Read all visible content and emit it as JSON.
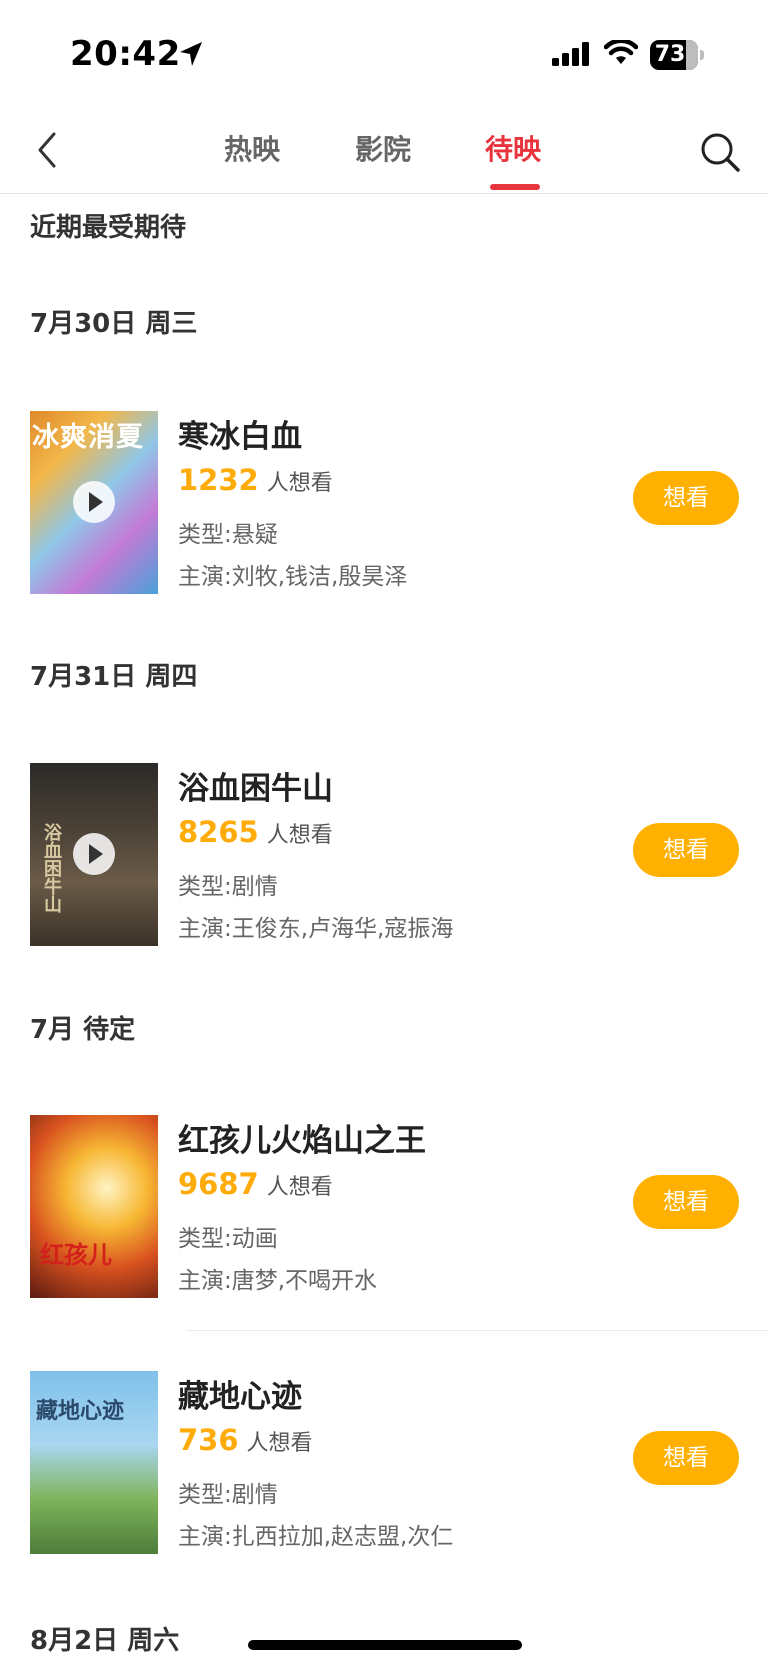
{
  "status_bar": {
    "time": "20:42",
    "battery": "73"
  },
  "nav": {
    "tabs": [
      {
        "label": "热映"
      },
      {
        "label": "影院"
      },
      {
        "label": "待映"
      }
    ],
    "active_tab": "待映"
  },
  "sections": {
    "featured_title": "近期最受期待",
    "dates": [
      "7月30日 周三",
      "7月31日 周四",
      "7月 待定",
      "8月2日 周六"
    ]
  },
  "movies": [
    {
      "title": "寒冰白血",
      "want_count": "1232",
      "want_suffix": "人想看",
      "genre": "类型:悬疑",
      "cast": "主演:刘牧,钱洁,殷昊泽",
      "button": "想看",
      "poster_text": "冰爽消夏"
    },
    {
      "title": "浴血困牛山",
      "want_count": "8265",
      "want_suffix": "人想看",
      "genre": "类型:剧情",
      "cast": "主演:王俊东,卢海华,寇振海",
      "button": "想看",
      "poster_text": "浴血困牛山"
    },
    {
      "title": "红孩儿火焰山之王",
      "want_count": "9687",
      "want_suffix": "人想看",
      "genre": "类型:动画",
      "cast": "主演:唐梦,不喝开水",
      "button": "想看",
      "poster_text": "红孩儿"
    },
    {
      "title": "藏地心迹",
      "want_count": "736",
      "want_suffix": "人想看",
      "genre": "类型:剧情",
      "cast": "主演:扎西拉加,赵志盟,次仁",
      "button": "想看",
      "poster_text": "藏地心迹"
    }
  ],
  "colors": {
    "accent_red": "#e8343d",
    "want_orange": "#ffac0a",
    "button_orange": "#ffb000"
  },
  "icons": [
    "location-arrow-icon",
    "signal-icon",
    "wifi-icon",
    "battery-icon",
    "back-arrow-icon",
    "search-icon",
    "play-icon"
  ]
}
